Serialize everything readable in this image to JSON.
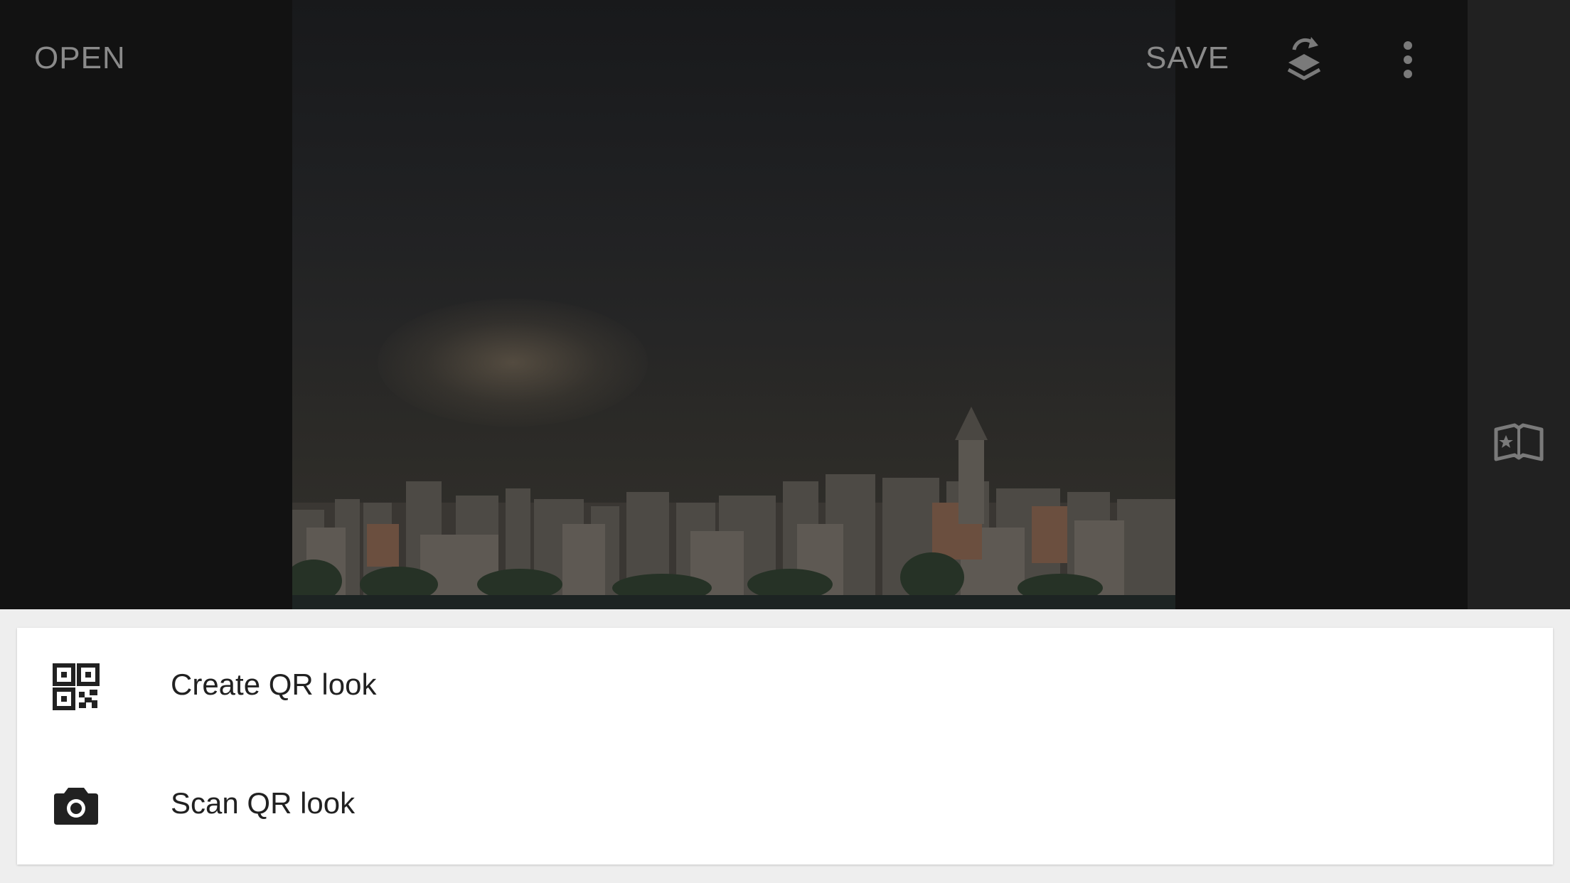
{
  "toolbar": {
    "open_label": "OPEN",
    "save_label": "SAVE",
    "layers_icon": "stack-undo-icon",
    "more_icon": "more-vert-icon"
  },
  "sidebar": {
    "looks_icon": "looks-book-icon"
  },
  "photo": {
    "description_icon": "photo-preview"
  },
  "sheet": {
    "items": [
      {
        "label": "Create QR look",
        "icon": "qr-code-icon"
      },
      {
        "label": "Scan QR look",
        "icon": "camera-icon"
      }
    ]
  },
  "colors": {
    "editor_bg": "#121212",
    "side_panel_bg": "#212121",
    "toolbar_text": "#8a8a8a",
    "sheet_bg": "#ffffff",
    "sheet_text": "#212121"
  }
}
